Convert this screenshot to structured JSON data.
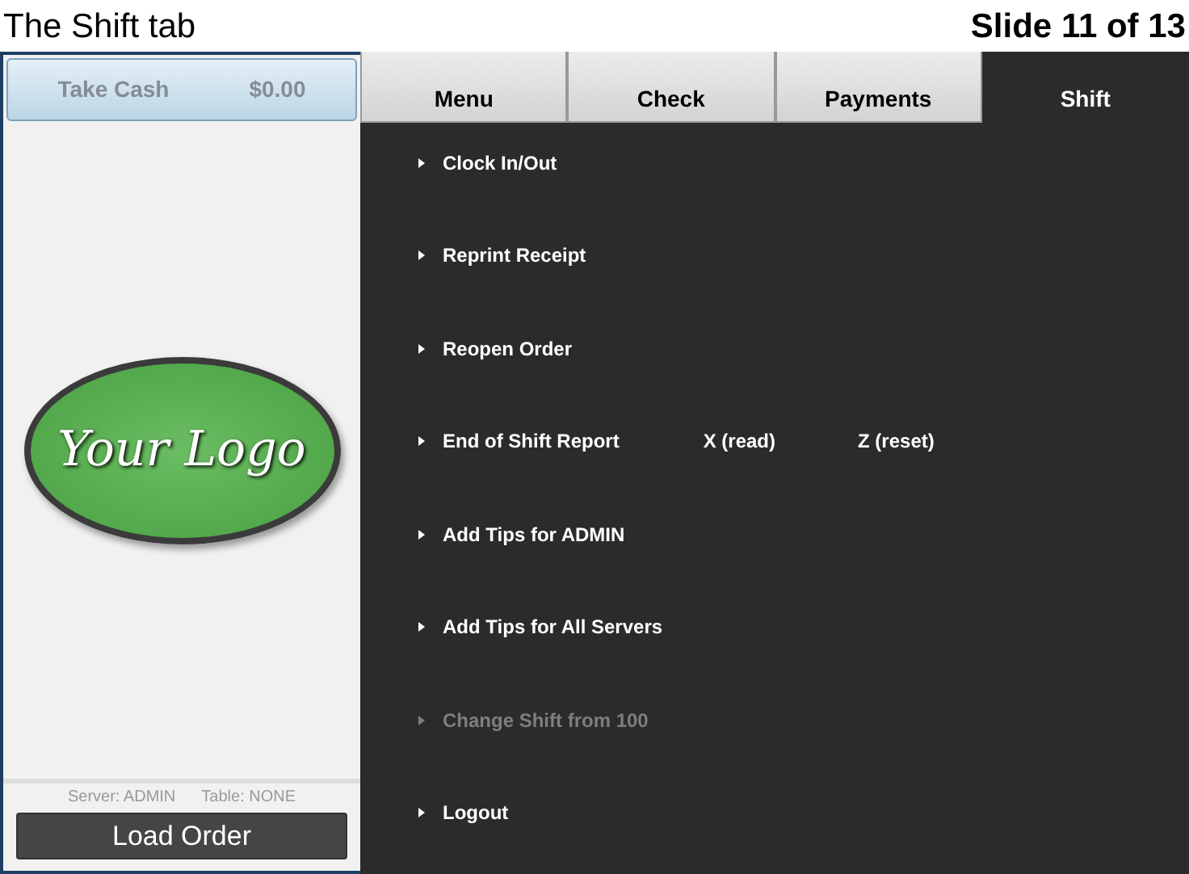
{
  "slide": {
    "title": "The Shift tab",
    "counter": "Slide 11 of 13"
  },
  "take_cash": {
    "label": "Take Cash",
    "amount": "$0.00",
    "disabled": true
  },
  "logo": {
    "text": "Your Logo"
  },
  "status": {
    "server": "Server: ADMIN",
    "table": "Table: NONE"
  },
  "load_button": "Load Order",
  "tabs": [
    {
      "label": "Menu",
      "selected": false
    },
    {
      "label": "Check",
      "selected": false
    },
    {
      "label": "Payments",
      "selected": false
    },
    {
      "label": "Shift",
      "selected": true
    }
  ],
  "menu_items": [
    {
      "label": "Clock In/Out",
      "disabled": false
    },
    {
      "label": "Reprint Receipt",
      "disabled": false
    },
    {
      "label": "Reopen Order",
      "disabled": false
    },
    {
      "label": "End of Shift Report",
      "disabled": false,
      "options": [
        "X (read)",
        "Z (reset)"
      ]
    },
    {
      "label": "Add Tips for ADMIN",
      "disabled": false
    },
    {
      "label": "Add Tips for All Servers",
      "disabled": false
    },
    {
      "label": "Change Shift from 100",
      "disabled": true
    },
    {
      "label": "Logout",
      "disabled": false
    }
  ]
}
